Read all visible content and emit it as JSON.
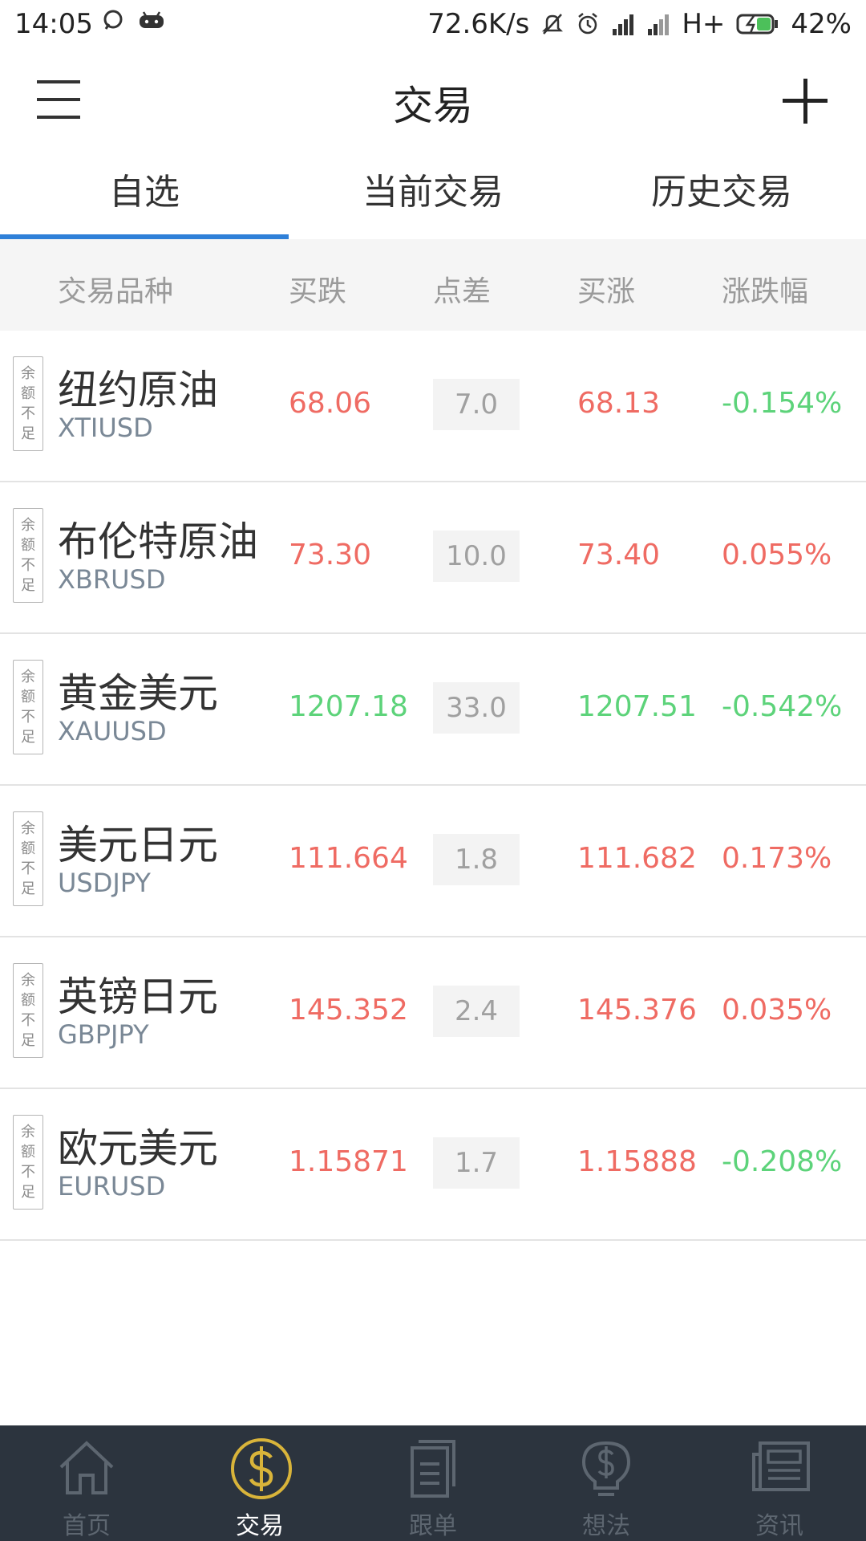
{
  "status_bar": {
    "time": "14:05",
    "speed": "72.6K/s",
    "network": "H+",
    "battery": "42%"
  },
  "header": {
    "title": "交易"
  },
  "tabs": [
    {
      "label": "自选",
      "active": true
    },
    {
      "label": "当前交易",
      "active": false
    },
    {
      "label": "历史交易",
      "active": false
    }
  ],
  "table_header": {
    "col_name": "交易品种",
    "col_bid": "买跌",
    "col_spread": "点差",
    "col_ask": "买涨",
    "col_change": "涨跌幅"
  },
  "badge_text": [
    "余",
    "额",
    "不",
    "足"
  ],
  "rows": [
    {
      "name_cn": "纽约原油",
      "code": "XTIUSD",
      "bid": "68.06",
      "spread": "7.0",
      "ask": "68.13",
      "change": "-0.154%",
      "price_color": "red",
      "change_color": "green"
    },
    {
      "name_cn": "布伦特原油",
      "code": "XBRUSD",
      "bid": "73.30",
      "spread": "10.0",
      "ask": "73.40",
      "change": "0.055%",
      "price_color": "red",
      "change_color": "red"
    },
    {
      "name_cn": "黄金美元",
      "code": "XAUUSD",
      "bid": "1207.18",
      "spread": "33.0",
      "ask": "1207.51",
      "change": "-0.542%",
      "price_color": "green",
      "change_color": "green"
    },
    {
      "name_cn": "美元日元",
      "code": "USDJPY",
      "bid": "111.664",
      "spread": "1.8",
      "ask": "111.682",
      "change": "0.173%",
      "price_color": "red",
      "change_color": "red"
    },
    {
      "name_cn": "英镑日元",
      "code": "GBPJPY",
      "bid": "145.352",
      "spread": "2.4",
      "ask": "145.376",
      "change": "0.035%",
      "price_color": "red",
      "change_color": "red"
    },
    {
      "name_cn": "欧元美元",
      "code": "EURUSD",
      "bid": "1.15871",
      "spread": "1.7",
      "ask": "1.15888",
      "change": "-0.208%",
      "price_color": "red",
      "change_color": "green"
    }
  ],
  "bottom_nav": [
    {
      "label": "首页",
      "icon": "home-icon",
      "active": false
    },
    {
      "label": "交易",
      "icon": "dollar-coin-icon",
      "active": true
    },
    {
      "label": "跟单",
      "icon": "document-icon",
      "active": false
    },
    {
      "label": "想法",
      "icon": "lightbulb-icon",
      "active": false
    },
    {
      "label": "资讯",
      "icon": "newspaper-icon",
      "active": false
    }
  ],
  "colors": {
    "accent_blue": "#2f80d8",
    "up_red": "#ef6b63",
    "down_green": "#5dd37a",
    "nav_bg": "#2c343e",
    "active_gold": "#d9b43a"
  }
}
